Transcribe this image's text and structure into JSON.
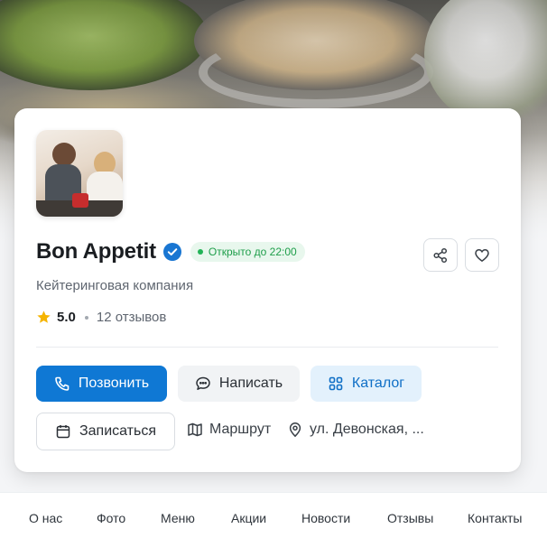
{
  "business": {
    "name": "Bon Appetit",
    "status": "Открыто до 22:00",
    "category": "Кейтеринговая компания",
    "rating": "5.0",
    "reviews": "12 отзывов"
  },
  "actions": {
    "call": "Позвонить",
    "message": "Написать",
    "catalog": "Каталог",
    "book": "Записаться",
    "route": "Маршрут",
    "address": "ул. Девонская, ..."
  },
  "tabs": [
    "О нас",
    "Фото",
    "Меню",
    "Акции",
    "Новости",
    "Отзывы",
    "Контакты"
  ],
  "colors": {
    "primary": "#0f78d4",
    "status_green": "#1e9e4a",
    "star": "#f5b400"
  },
  "icons": {
    "verified": "verified-check-icon",
    "share": "share-icon",
    "favorite": "heart-icon",
    "star": "star-icon",
    "call": "phone-icon",
    "message": "chat-bubble-icon",
    "catalog": "grid-icon",
    "book": "calendar-icon",
    "route": "map-icon",
    "address": "location-pin-icon"
  }
}
